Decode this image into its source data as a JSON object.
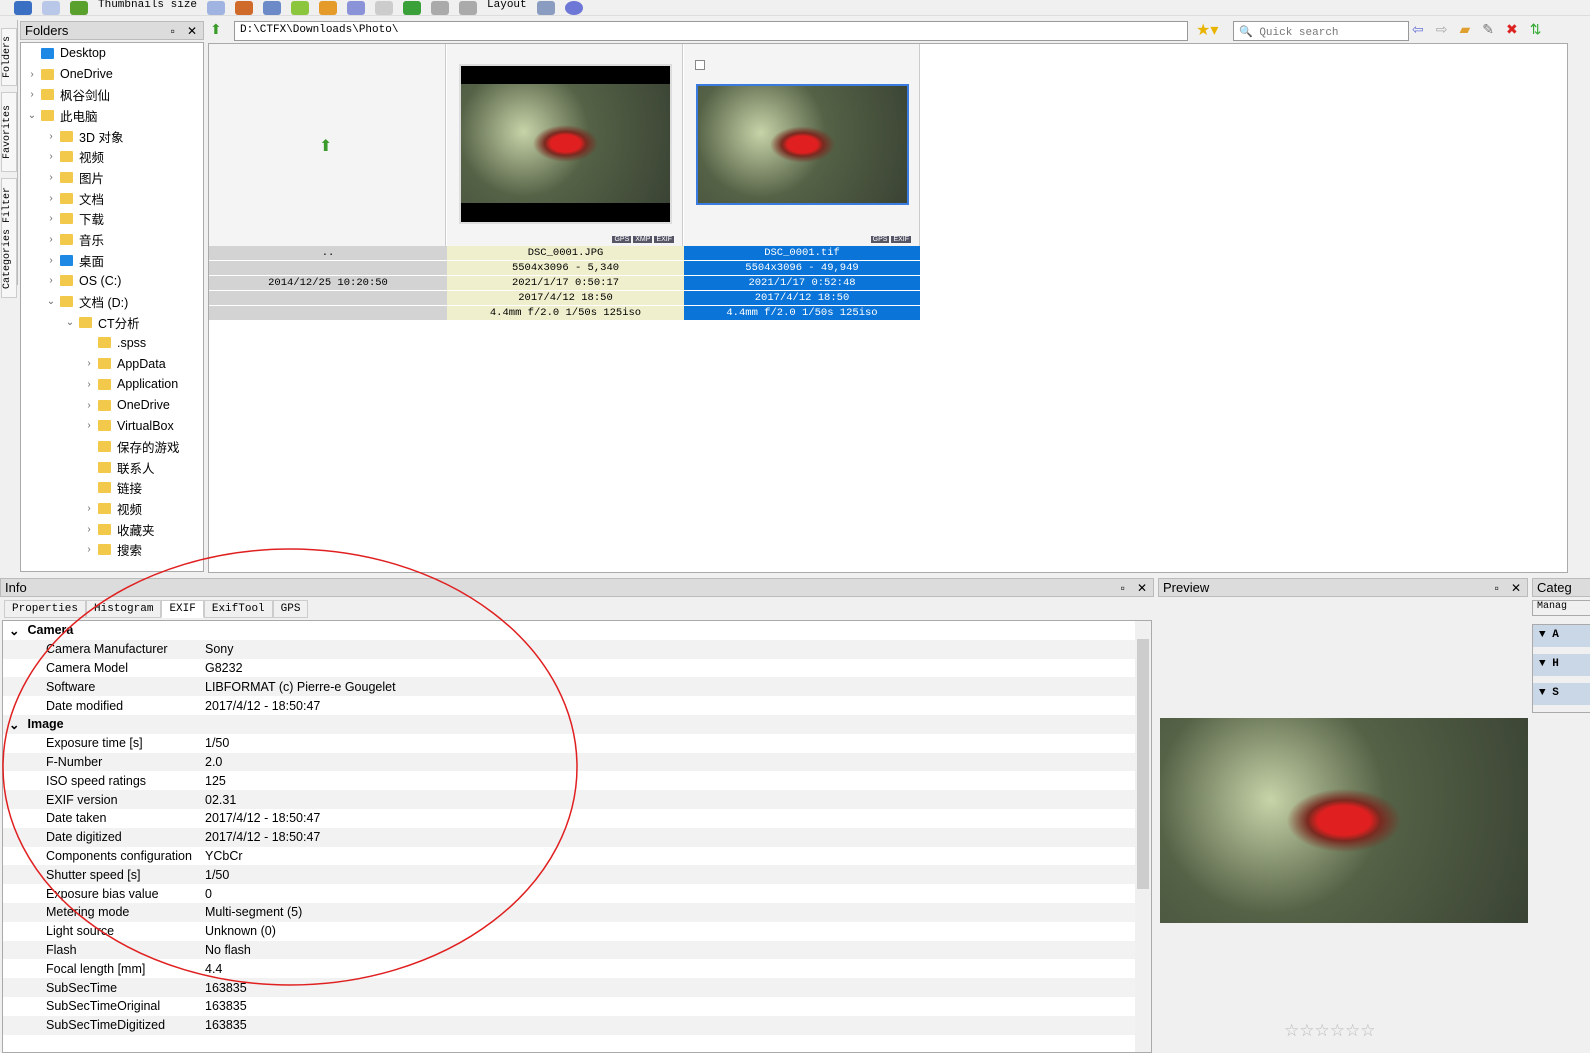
{
  "toolbar": {
    "thumbnails_size": "Thumbnails size",
    "layout": "Layout"
  },
  "vertical_tabs": [
    "Folders",
    "Favorites",
    "Categories Filter"
  ],
  "folders": {
    "title": "Folders",
    "items": [
      {
        "label": "Desktop",
        "level": 0,
        "chevron": ""
      },
      {
        "label": "OneDrive",
        "level": 0,
        "chevron": ">"
      },
      {
        "label": "枫谷剑仙",
        "level": 0,
        "chevron": ">"
      },
      {
        "label": "此电脑",
        "level": 0,
        "chevron": "v"
      },
      {
        "label": "3D 对象",
        "level": 1,
        "chevron": ">"
      },
      {
        "label": "视频",
        "level": 1,
        "chevron": ">"
      },
      {
        "label": "图片",
        "level": 1,
        "chevron": ">"
      },
      {
        "label": "文档",
        "level": 1,
        "chevron": ">"
      },
      {
        "label": "下载",
        "level": 1,
        "chevron": ">"
      },
      {
        "label": "音乐",
        "level": 1,
        "chevron": ">"
      },
      {
        "label": "桌面",
        "level": 1,
        "chevron": ">"
      },
      {
        "label": "OS (C:)",
        "level": 1,
        "chevron": ">"
      },
      {
        "label": "文档 (D:)",
        "level": 1,
        "chevron": "v"
      },
      {
        "label": "CT分析",
        "level": 2,
        "chevron": "v"
      },
      {
        "label": ".spss",
        "level": 3,
        "chevron": ""
      },
      {
        "label": "AppData",
        "level": 3,
        "chevron": ">"
      },
      {
        "label": "Application",
        "level": 3,
        "chevron": ">"
      },
      {
        "label": "OneDrive",
        "level": 3,
        "chevron": ">"
      },
      {
        "label": "VirtualBox",
        "level": 3,
        "chevron": ">"
      },
      {
        "label": "保存的游戏",
        "level": 3,
        "chevron": ""
      },
      {
        "label": "联系人",
        "level": 3,
        "chevron": ""
      },
      {
        "label": "链接",
        "level": 3,
        "chevron": ""
      },
      {
        "label": "视频",
        "level": 3,
        "chevron": ">"
      },
      {
        "label": "收藏夹",
        "level": 3,
        "chevron": ">"
      },
      {
        "label": "搜索",
        "level": 3,
        "chevron": ">"
      }
    ]
  },
  "address": {
    "path": "D:\\CTFX\\Downloads\\Photo\\"
  },
  "search": {
    "placeholder": "Quick search"
  },
  "thumbnails": [
    {
      "name": "..",
      "size": "",
      "created": "2014/12/25 10:20:50",
      "taken": "",
      "exposure": ""
    },
    {
      "name": "DSC_0001.JPG",
      "size": "5504x3096 - 5,340",
      "created": "2021/1/17 0:50:17",
      "taken": "2017/4/12 18:50",
      "exposure": "4.4mm f/2.0 1/50s 125iso",
      "badges": [
        "GPS",
        "XMP",
        "EXIF"
      ]
    },
    {
      "name": "DSC_0001.tif",
      "size": "5504x3096 - 49,949",
      "created": "2021/1/17 0:52:48",
      "taken": "2017/4/12 18:50",
      "exposure": "4.4mm f/2.0 1/50s 125iso",
      "badges": [
        "GPS",
        "EXIF"
      ]
    }
  ],
  "info": {
    "title": "Info",
    "tabs": [
      "Properties",
      "Histogram",
      "EXIF",
      "ExifTool",
      "GPS"
    ],
    "active_tab": "EXIF",
    "groups": [
      {
        "name": "Camera",
        "rows": [
          [
            "Camera Manufacturer",
            "Sony"
          ],
          [
            "Camera Model",
            "G8232"
          ],
          [
            "Software",
            "LIBFORMAT (c) Pierre-e Gougelet"
          ],
          [
            "Date modified",
            "2017/4/12 - 18:50:47"
          ]
        ]
      },
      {
        "name": "Image",
        "rows": [
          [
            "Exposure time [s]",
            "1/50"
          ],
          [
            "F-Number",
            "2.0"
          ],
          [
            "ISO speed ratings",
            "125"
          ],
          [
            "EXIF version",
            "02.31"
          ],
          [
            "Date taken",
            "2017/4/12 - 18:50:47"
          ],
          [
            "Date digitized",
            "2017/4/12 - 18:50:47"
          ],
          [
            "Components configuration",
            "YCbCr"
          ],
          [
            "Shutter speed [s]",
            "1/50"
          ],
          [
            "Exposure bias value",
            "0"
          ],
          [
            "Metering mode",
            "Multi-segment (5)"
          ],
          [
            "Light source",
            "Unknown (0)"
          ],
          [
            "Flash",
            "No flash"
          ],
          [
            "Focal length [mm]",
            "4.4"
          ],
          [
            "SubSecTime",
            "163835"
          ],
          [
            "SubSecTimeOriginal",
            "163835"
          ],
          [
            "SubSecTimeDigitized",
            "163835"
          ]
        ]
      }
    ]
  },
  "preview": {
    "title": "Preview",
    "rating_stars": "☆☆☆☆☆☆"
  },
  "categories": {
    "title": "Categ",
    "manage": "Manag",
    "items": [
      "A",
      "H",
      "S"
    ]
  }
}
